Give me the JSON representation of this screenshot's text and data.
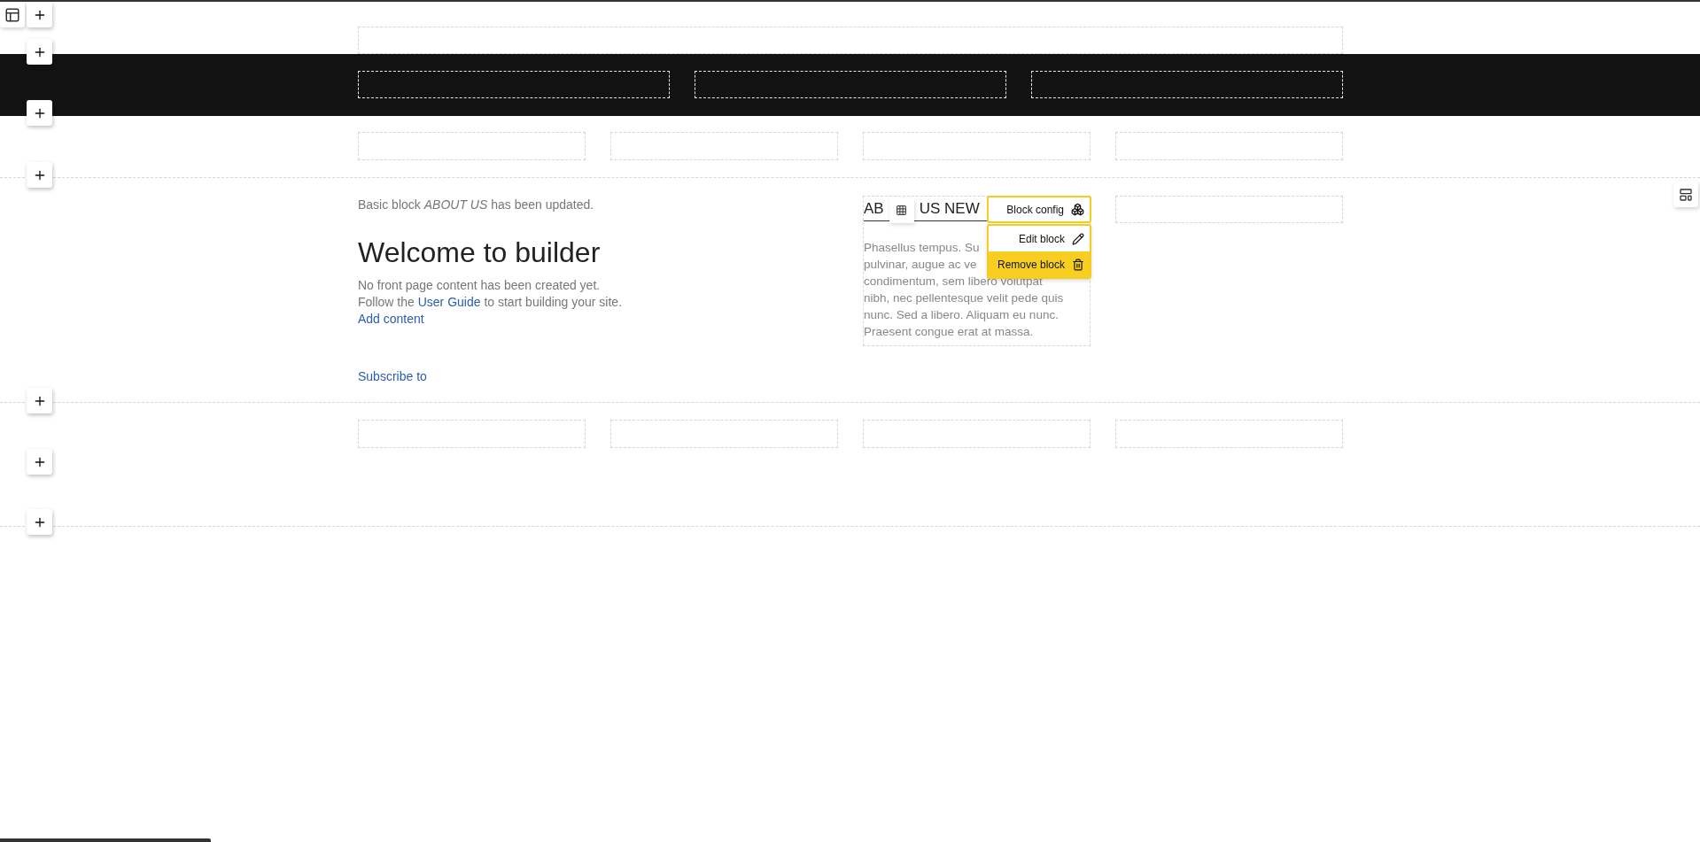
{
  "status_message": "Basic block *ABOUT US* has been updated.",
  "welcome": {
    "title": "Welcome to builder",
    "intro": "No front page content has been created yet.",
    "guide_before": "Follow the",
    "guide_link": "User Guide",
    "guide_after": "to start building your site.",
    "add_content_link": "Add content"
  },
  "subscribe_link": "Subscribe to",
  "block": {
    "heading_parts": [
      "AB",
      "US NEW"
    ],
    "body_lines": [
      "Phasellus tempus. Su",
      "pulvinar, augue ac ve",
      "condimentum, sem libero volutpat",
      "nibh, nec pellentesque velit pede quis",
      "nunc. Sed a libero. Aliquam eu nunc.",
      "Praesent congue erat at massa."
    ]
  },
  "block_menu": {
    "config_label": "Block config",
    "items": [
      {
        "kind": "edit",
        "label": "Edit block",
        "selected": false
      },
      {
        "kind": "remove",
        "label": "Remove block",
        "selected": true
      }
    ]
  }
}
